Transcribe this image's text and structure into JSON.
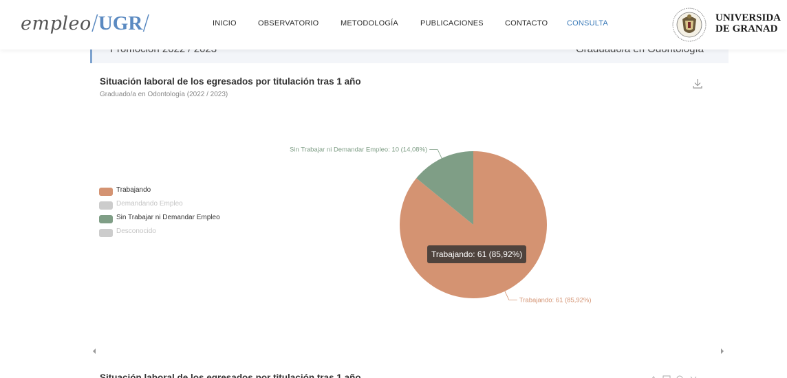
{
  "header": {
    "logo": {
      "empleo": "empleo",
      "slash1": "/",
      "ugr": "UGR",
      "slash2": "/"
    },
    "nav": [
      {
        "label": "INICIO",
        "active": false
      },
      {
        "label": "OBSERVATORIO",
        "active": false
      },
      {
        "label": "METODOLOGÍA",
        "active": false
      },
      {
        "label": "PUBLICACIONES",
        "active": false
      },
      {
        "label": "CONTACTO",
        "active": false
      },
      {
        "label": "CONSULTA",
        "active": true
      }
    ],
    "university": {
      "line1": "UNIVERSIDA",
      "line2": "DE GRANAD"
    }
  },
  "banner": {
    "left": "Promoción 2022 / 2023",
    "right": "Graduado/a en Odontología"
  },
  "chart": {
    "title": "Situación laboral de los egresados por titulación tras 1 año",
    "subtitle": "Graduado/a en Odontología (2022 / 2023)",
    "tooltip": "Trabajando: 61 (85,92%)",
    "label_working": "Trabajando: 61 (85,92%)",
    "label_not_working": "Sin Trabajar ni Demandar Empleo: 10 (14,08%)"
  },
  "chart_data": {
    "type": "pie",
    "title": "Situación laboral de los egresados por titulación tras 1 año",
    "subtitle": "Graduado/a en Odontología (2022 / 2023)",
    "legend_position": "left",
    "slices": [
      {
        "name": "Trabajando",
        "value": 61,
        "percent": 85.92,
        "color": "#d49372",
        "visible": true
      },
      {
        "name": "Demandando Empleo",
        "value": 0,
        "percent": 0,
        "color": "#cccccc",
        "visible": false
      },
      {
        "name": "Sin Trabajar ni Demandar Empleo",
        "value": 10,
        "percent": 14.08,
        "color": "#7f9e86",
        "visible": true
      },
      {
        "name": "Desconocido",
        "value": 0,
        "percent": 0,
        "color": "#cccccc",
        "visible": false
      }
    ]
  },
  "legend": [
    {
      "label": "Trabajando",
      "color": "#d49372",
      "enabled": true
    },
    {
      "label": "Demandando Empleo",
      "color": "#cccccc",
      "enabled": false
    },
    {
      "label": "Sin Trabajar ni Demandar Empleo",
      "color": "#7f9e86",
      "enabled": true
    },
    {
      "label": "Desconocido",
      "color": "#cccccc",
      "enabled": false
    }
  ],
  "next_card": {
    "title": "Situación laboral de los egresados por titulación tras 1 año"
  },
  "icons": {
    "download": "download-icon",
    "scroll_left": "chevron-left-icon",
    "scroll_right": "chevron-right-icon",
    "crest": "university-crest-icon"
  }
}
